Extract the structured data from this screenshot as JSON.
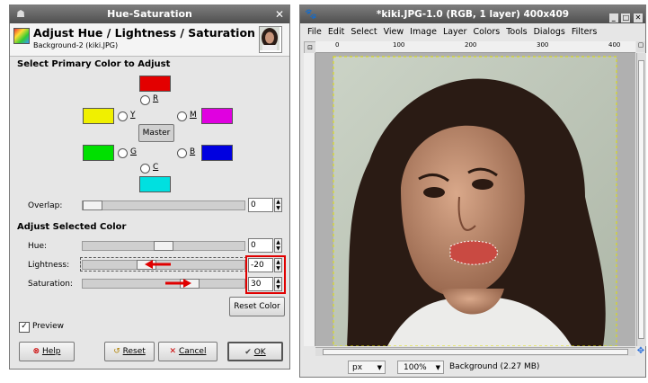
{
  "hs_dialog": {
    "title": "Hue-Saturation",
    "heading": "Adjust Hue / Lightness / Saturation",
    "subheading": "Background-2 (kiki.JPG)",
    "section_primary": "Select Primary Color to Adjust",
    "colors": {
      "r": "#e30000",
      "y": "#f0f000",
      "m": "#e000e0",
      "g": "#00e000",
      "b": "#0000e0",
      "c": "#00e0e0"
    },
    "labels": {
      "r": "R",
      "y": "Y",
      "m": "M",
      "g": "G",
      "b": "B",
      "c": "C"
    },
    "master_label": "Master",
    "overlap_label": "Overlap:",
    "overlap_value": "0",
    "section_adjust": "Adjust Selected Color",
    "hue_label": "Hue:",
    "hue_value": "0",
    "lightness_label": "Lightness:",
    "lightness_value": "-20",
    "saturation_label": "Saturation:",
    "saturation_value": "30",
    "reset_color_label": "Reset Color",
    "preview_label": "Preview",
    "help_label": "Help",
    "reset_label": "Reset",
    "cancel_label": "Cancel",
    "ok_label": "OK"
  },
  "image_window": {
    "title": "*kiki.JPG-1.0 (RGB, 1 layer) 400x409",
    "menu": [
      "File",
      "Edit",
      "Select",
      "View",
      "Image",
      "Layer",
      "Colors",
      "Tools",
      "Dialogs",
      "Filters"
    ],
    "ruler_ticks": [
      "0",
      "100",
      "200",
      "300",
      "400"
    ],
    "unit": "px",
    "zoom": "100%",
    "status": "Background (2.27 MB)"
  }
}
